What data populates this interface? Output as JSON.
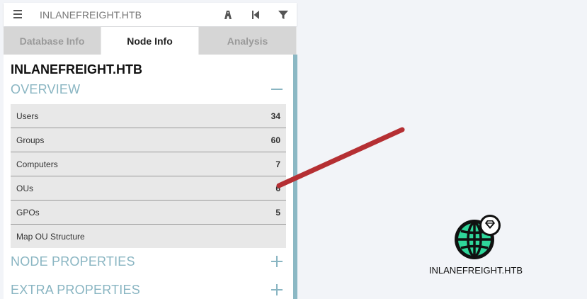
{
  "search": {
    "text": "INLANEFREIGHT.HTB",
    "icons": [
      "menu-icon",
      "pathfinding-icon",
      "back-icon",
      "filter-icon"
    ]
  },
  "tabs": [
    {
      "label": "Database Info",
      "active": false
    },
    {
      "label": "Node Info",
      "active": true
    },
    {
      "label": "Analysis",
      "active": false
    }
  ],
  "node": {
    "title": "INLANEFREIGHT.HTB"
  },
  "sections": {
    "overview": "OVERVIEW",
    "node_properties": "NODE PROPERTIES",
    "extra_properties": "EXTRA PROPERTIES"
  },
  "overview": [
    {
      "label": "Users",
      "value": "34"
    },
    {
      "label": "Groups",
      "value": "60"
    },
    {
      "label": "Computers",
      "value": "7"
    },
    {
      "label": "OUs",
      "value": "6"
    },
    {
      "label": "GPOs",
      "value": "5"
    },
    {
      "label": "Map OU Structure",
      "value": ""
    }
  ],
  "graph": {
    "node_label": "INLANEFREIGHT.HTB",
    "node_icon": "globe-icon",
    "badge_icon": "gem-icon"
  },
  "colors": {
    "accent": "#89b5c2",
    "globe_fill": "#2fd69a",
    "annotation_line": "#b52f33"
  }
}
